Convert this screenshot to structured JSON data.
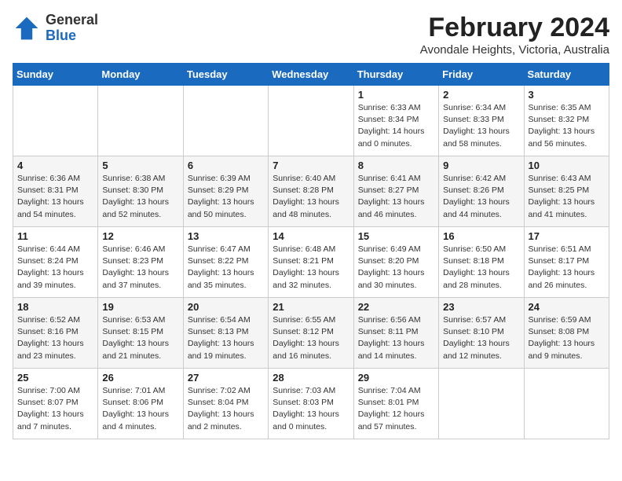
{
  "header": {
    "logo_general": "General",
    "logo_blue": "Blue",
    "title": "February 2024",
    "subtitle": "Avondale Heights, Victoria, Australia"
  },
  "columns": [
    "Sunday",
    "Monday",
    "Tuesday",
    "Wednesday",
    "Thursday",
    "Friday",
    "Saturday"
  ],
  "weeks": [
    [
      {
        "day": "",
        "info": ""
      },
      {
        "day": "",
        "info": ""
      },
      {
        "day": "",
        "info": ""
      },
      {
        "day": "",
        "info": ""
      },
      {
        "day": "1",
        "info": "Sunrise: 6:33 AM\nSunset: 8:34 PM\nDaylight: 14 hours\nand 0 minutes."
      },
      {
        "day": "2",
        "info": "Sunrise: 6:34 AM\nSunset: 8:33 PM\nDaylight: 13 hours\nand 58 minutes."
      },
      {
        "day": "3",
        "info": "Sunrise: 6:35 AM\nSunset: 8:32 PM\nDaylight: 13 hours\nand 56 minutes."
      }
    ],
    [
      {
        "day": "4",
        "info": "Sunrise: 6:36 AM\nSunset: 8:31 PM\nDaylight: 13 hours\nand 54 minutes."
      },
      {
        "day": "5",
        "info": "Sunrise: 6:38 AM\nSunset: 8:30 PM\nDaylight: 13 hours\nand 52 minutes."
      },
      {
        "day": "6",
        "info": "Sunrise: 6:39 AM\nSunset: 8:29 PM\nDaylight: 13 hours\nand 50 minutes."
      },
      {
        "day": "7",
        "info": "Sunrise: 6:40 AM\nSunset: 8:28 PM\nDaylight: 13 hours\nand 48 minutes."
      },
      {
        "day": "8",
        "info": "Sunrise: 6:41 AM\nSunset: 8:27 PM\nDaylight: 13 hours\nand 46 minutes."
      },
      {
        "day": "9",
        "info": "Sunrise: 6:42 AM\nSunset: 8:26 PM\nDaylight: 13 hours\nand 44 minutes."
      },
      {
        "day": "10",
        "info": "Sunrise: 6:43 AM\nSunset: 8:25 PM\nDaylight: 13 hours\nand 41 minutes."
      }
    ],
    [
      {
        "day": "11",
        "info": "Sunrise: 6:44 AM\nSunset: 8:24 PM\nDaylight: 13 hours\nand 39 minutes."
      },
      {
        "day": "12",
        "info": "Sunrise: 6:46 AM\nSunset: 8:23 PM\nDaylight: 13 hours\nand 37 minutes."
      },
      {
        "day": "13",
        "info": "Sunrise: 6:47 AM\nSunset: 8:22 PM\nDaylight: 13 hours\nand 35 minutes."
      },
      {
        "day": "14",
        "info": "Sunrise: 6:48 AM\nSunset: 8:21 PM\nDaylight: 13 hours\nand 32 minutes."
      },
      {
        "day": "15",
        "info": "Sunrise: 6:49 AM\nSunset: 8:20 PM\nDaylight: 13 hours\nand 30 minutes."
      },
      {
        "day": "16",
        "info": "Sunrise: 6:50 AM\nSunset: 8:18 PM\nDaylight: 13 hours\nand 28 minutes."
      },
      {
        "day": "17",
        "info": "Sunrise: 6:51 AM\nSunset: 8:17 PM\nDaylight: 13 hours\nand 26 minutes."
      }
    ],
    [
      {
        "day": "18",
        "info": "Sunrise: 6:52 AM\nSunset: 8:16 PM\nDaylight: 13 hours\nand 23 minutes."
      },
      {
        "day": "19",
        "info": "Sunrise: 6:53 AM\nSunset: 8:15 PM\nDaylight: 13 hours\nand 21 minutes."
      },
      {
        "day": "20",
        "info": "Sunrise: 6:54 AM\nSunset: 8:13 PM\nDaylight: 13 hours\nand 19 minutes."
      },
      {
        "day": "21",
        "info": "Sunrise: 6:55 AM\nSunset: 8:12 PM\nDaylight: 13 hours\nand 16 minutes."
      },
      {
        "day": "22",
        "info": "Sunrise: 6:56 AM\nSunset: 8:11 PM\nDaylight: 13 hours\nand 14 minutes."
      },
      {
        "day": "23",
        "info": "Sunrise: 6:57 AM\nSunset: 8:10 PM\nDaylight: 13 hours\nand 12 minutes."
      },
      {
        "day": "24",
        "info": "Sunrise: 6:59 AM\nSunset: 8:08 PM\nDaylight: 13 hours\nand 9 minutes."
      }
    ],
    [
      {
        "day": "25",
        "info": "Sunrise: 7:00 AM\nSunset: 8:07 PM\nDaylight: 13 hours\nand 7 minutes."
      },
      {
        "day": "26",
        "info": "Sunrise: 7:01 AM\nSunset: 8:06 PM\nDaylight: 13 hours\nand 4 minutes."
      },
      {
        "day": "27",
        "info": "Sunrise: 7:02 AM\nSunset: 8:04 PM\nDaylight: 13 hours\nand 2 minutes."
      },
      {
        "day": "28",
        "info": "Sunrise: 7:03 AM\nSunset: 8:03 PM\nDaylight: 13 hours\nand 0 minutes."
      },
      {
        "day": "29",
        "info": "Sunrise: 7:04 AM\nSunset: 8:01 PM\nDaylight: 12 hours\nand 57 minutes."
      },
      {
        "day": "",
        "info": ""
      },
      {
        "day": "",
        "info": ""
      }
    ]
  ]
}
